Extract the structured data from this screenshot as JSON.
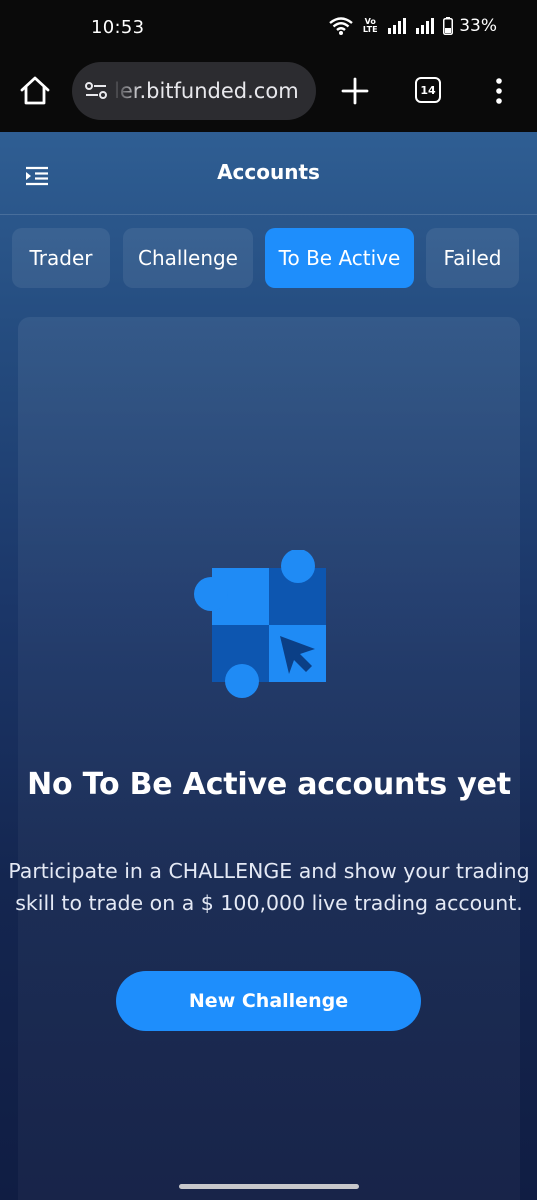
{
  "status_bar": {
    "time": "10:53",
    "volte_top": "Vo",
    "volte_bottom": "LTE",
    "battery": "33%"
  },
  "browser": {
    "url": "ler.bitfunded.com",
    "tab_count": "14",
    "icons": [
      "home-icon",
      "site-info-icon",
      "plus-icon",
      "tab-switcher-icon",
      "more-vert-icon"
    ]
  },
  "header": {
    "title": "Accounts",
    "menu_icon": "menu-collapse-icon"
  },
  "tabs": [
    {
      "label": "Trader",
      "active": false
    },
    {
      "label": "Challenge",
      "active": false
    },
    {
      "label": "To Be Active",
      "active": true
    },
    {
      "label": "Failed",
      "active": false
    }
  ],
  "empty_state": {
    "illustration": "puzzle-cursor-icon",
    "title": "No To Be Active accounts yet",
    "description": "Participate in a CHALLENGE and show your trading skill to trade on a $ 100,000 live trading account.",
    "button_label": "New Challenge"
  },
  "colors": {
    "accent": "#1e8efc",
    "status_bar_bg": "#0a0a0a",
    "page_bg_top": "#2f5e93",
    "page_bg_bottom": "#101d43"
  }
}
